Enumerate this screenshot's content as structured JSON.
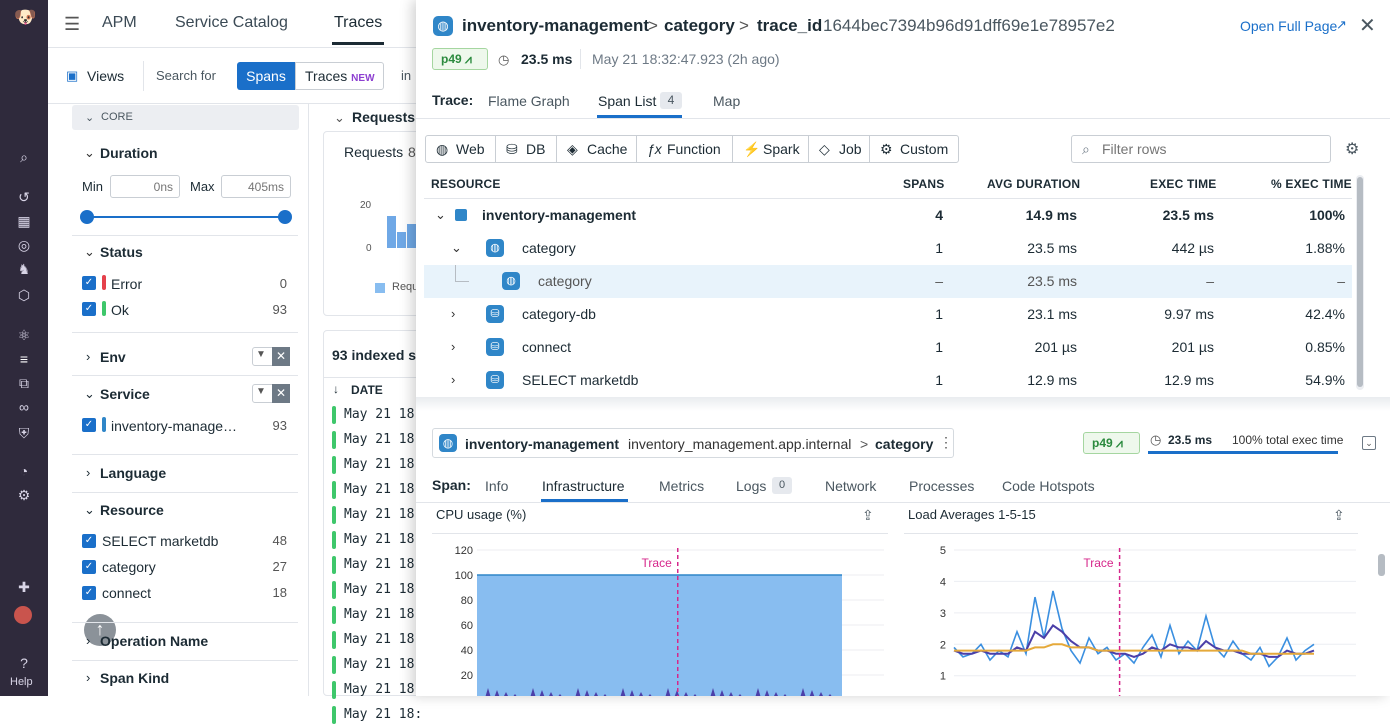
{
  "rail": {
    "help_label": "Help"
  },
  "topnav": {
    "apm": "APM",
    "service_catalog": "Service Catalog",
    "traces": "Traces"
  },
  "subbar": {
    "views": "Views",
    "search_for": "Search for",
    "spans": "Spans",
    "traces": "Traces",
    "traces_badge": "NEW",
    "in": "in"
  },
  "facets": {
    "core_label": "CORE",
    "duration": {
      "title": "Duration",
      "min_label": "Min",
      "min_placeholder": "0ns",
      "max_label": "Max",
      "max_placeholder": "405ms"
    },
    "status": {
      "title": "Status",
      "items": [
        {
          "label": "Error",
          "count": "0",
          "color": "#e5414b"
        },
        {
          "label": "Ok",
          "count": "93",
          "color": "#3ec76b"
        }
      ]
    },
    "env": {
      "title": "Env"
    },
    "service": {
      "title": "Service",
      "items": [
        {
          "label": "inventory-manage…",
          "count": "93"
        }
      ]
    },
    "language": {
      "title": "Language"
    },
    "resource": {
      "title": "Resource",
      "items": [
        {
          "label": "SELECT marketdb",
          "count": "48"
        },
        {
          "label": "category",
          "count": "27"
        },
        {
          "label": "connect",
          "count": "18"
        }
      ]
    },
    "operation_name": {
      "title": "Operation Name"
    },
    "span_kind": {
      "title": "Span Kind"
    }
  },
  "middle": {
    "requests_header": "Requests,",
    "requests_label": "Requests",
    "requests_count": "8",
    "ytick_20": "20",
    "ytick_0": "0",
    "legend": "Requ",
    "indexed": "93 indexed sp",
    "date_col": "DATE",
    "date_rows": [
      "May 21 18:",
      "May 21 18:",
      "May 21 18:",
      "May 21 18:",
      "May 21 18:",
      "May 21 18:",
      "May 21 18:",
      "May 21 18:",
      "May 21 18:",
      "May 21 18:",
      "May 21 18:",
      "May 21 18:",
      "May 21 18:"
    ]
  },
  "header": {
    "service": "inventory-management",
    "sep1": ">",
    "resource": "category",
    "sep2": ">",
    "trace_id_label": "trace_id",
    "trace_id": "1644bec7394b96d91dff69e1e78957e2",
    "open_full_page": "Open Full Page",
    "p49": "p49",
    "duration": "23.5 ms",
    "timestamp": "May 21 18:32:47.923 (2h ago)"
  },
  "trace_tabs": {
    "label": "Trace:",
    "flame_graph": "Flame Graph",
    "span_list": "Span List",
    "span_list_count": "4",
    "map": "Map"
  },
  "type_filters": [
    "Web",
    "DB",
    "Cache",
    "Function",
    "Spark",
    "Job",
    "Custom"
  ],
  "filter_placeholder": "Filter rows",
  "table": {
    "columns": {
      "resource": "RESOURCE",
      "spans": "SPANS",
      "avg": "AVG DURATION",
      "exec": "EXEC TIME",
      "pct": "% EXEC TIME"
    },
    "rows": [
      {
        "name": "inventory-management",
        "spans": "4",
        "avg": "14.9 ms",
        "exec": "23.5 ms",
        "pct": "100%"
      },
      {
        "name": "category",
        "spans": "1",
        "avg": "23.5 ms",
        "exec": "442 µs",
        "pct": "1.88%"
      },
      {
        "name": "category",
        "spans": "–",
        "avg": "23.5 ms",
        "exec": "–",
        "pct": "–"
      },
      {
        "name": "category-db",
        "spans": "1",
        "avg": "23.1 ms",
        "exec": "9.97 ms",
        "pct": "42.4%"
      },
      {
        "name": "connect",
        "spans": "1",
        "avg": "201 µs",
        "exec": "201 µs",
        "pct": "0.85%"
      },
      {
        "name": "SELECT marketdb",
        "spans": "1",
        "avg": "12.9 ms",
        "exec": "12.9 ms",
        "pct": "54.9%"
      }
    ]
  },
  "span": {
    "service": "inventory-management",
    "host": "inventory_management.app.internal",
    "sep": ">",
    "resource": "category",
    "p49": "p49",
    "duration": "23.5 ms",
    "exec_total": "100% total exec time",
    "exec_fraction": 1.0
  },
  "span_tabs": {
    "label": "Span:",
    "info": "Info",
    "infrastructure": "Infrastructure",
    "metrics": "Metrics",
    "logs": "Logs",
    "logs_count": "0",
    "network": "Network",
    "processes": "Processes",
    "code_hotspots": "Code Hotspots"
  },
  "chart_data": [
    {
      "type": "area",
      "title": "CPU usage (%)",
      "marker": "Trace",
      "yticks": [
        "120",
        "100",
        "80",
        "60",
        "40",
        "20"
      ],
      "ylim": [
        0,
        120
      ],
      "series": [
        {
          "values": [
            100,
            100,
            100,
            100,
            100,
            100,
            100,
            100,
            100,
            100,
            100,
            100,
            100,
            100,
            100,
            100,
            100,
            100,
            100,
            100
          ]
        }
      ],
      "marker_position": 0.55
    },
    {
      "type": "line",
      "title": "Load Averages 1-5-15",
      "marker": "Trace",
      "yticks": [
        "5",
        "4",
        "3",
        "2",
        "1"
      ],
      "ylim": [
        0.8,
        5
      ],
      "series": [
        {
          "color": "#3a8fe0",
          "values": [
            1.9,
            1.6,
            1.7,
            2.0,
            1.5,
            1.8,
            1.6,
            2.4,
            1.7,
            3.5,
            2.2,
            3.7,
            2.5,
            1.8,
            1.4,
            2.2,
            1.7,
            1.9,
            1.5,
            1.7,
            1.4,
            1.9,
            2.3,
            1.6,
            2.6,
            1.7,
            2.1,
            1.8,
            2.9,
            1.9,
            1.6,
            2.1,
            1.7,
            1.5,
            1.9,
            1.3,
            1.6,
            2.2,
            1.5,
            1.8,
            2.0
          ]
        },
        {
          "color": "#4b3fa8",
          "values": [
            1.8,
            1.7,
            1.7,
            1.8,
            1.7,
            1.7,
            1.7,
            1.9,
            1.8,
            2.4,
            2.2,
            2.6,
            2.4,
            2.1,
            1.9,
            1.9,
            1.8,
            1.8,
            1.7,
            1.7,
            1.6,
            1.7,
            1.9,
            1.8,
            2.0,
            1.9,
            1.9,
            1.8,
            2.1,
            1.9,
            1.8,
            1.8,
            1.7,
            1.7,
            1.7,
            1.6,
            1.6,
            1.8,
            1.7,
            1.7,
            1.8
          ]
        },
        {
          "color": "#e5a93a",
          "values": [
            1.8,
            1.8,
            1.8,
            1.8,
            1.8,
            1.8,
            1.8,
            1.8,
            1.8,
            1.9,
            1.9,
            2.0,
            2.0,
            1.9,
            1.9,
            1.9,
            1.8,
            1.8,
            1.8,
            1.8,
            1.8,
            1.8,
            1.8,
            1.8,
            1.8,
            1.8,
            1.8,
            1.8,
            1.8,
            1.8,
            1.8,
            1.8,
            1.8,
            1.7,
            1.7,
            1.7,
            1.7,
            1.7,
            1.7,
            1.7,
            1.7
          ]
        }
      ],
      "marker_position": 0.46
    }
  ]
}
